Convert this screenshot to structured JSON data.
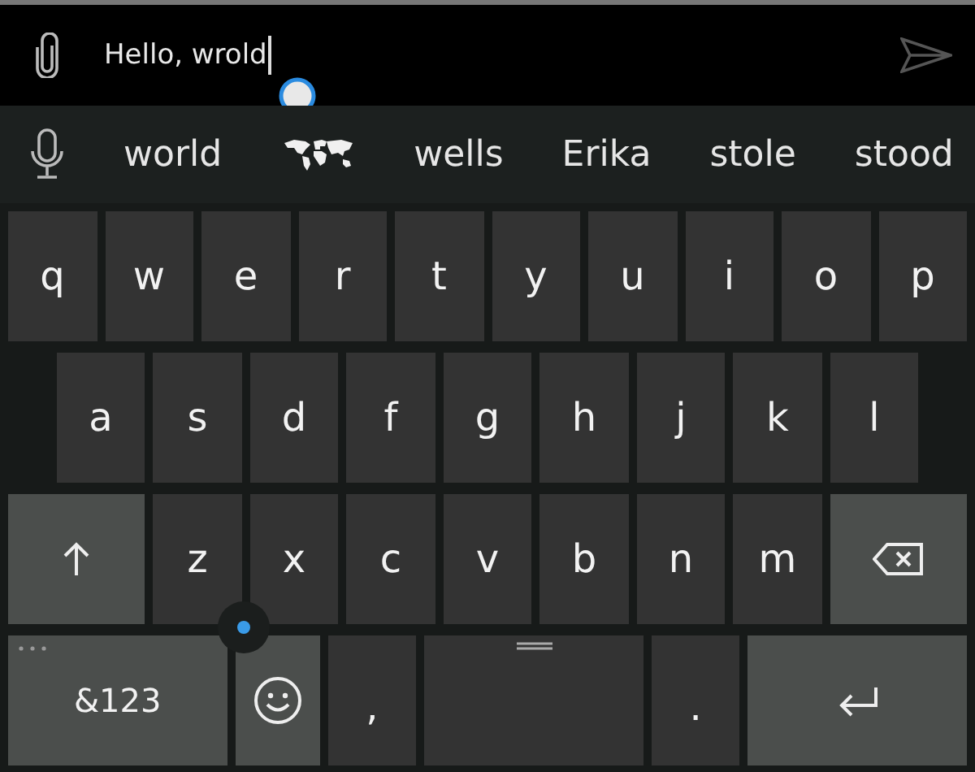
{
  "message_field": {
    "value": "Hello, wrold"
  },
  "suggestions": [
    {
      "kind": "word",
      "text": "world"
    },
    {
      "kind": "emoji"
    },
    {
      "kind": "word",
      "text": "wells"
    },
    {
      "kind": "word",
      "text": "Erika"
    },
    {
      "kind": "word",
      "text": "stole"
    },
    {
      "kind": "word",
      "text": "stood"
    }
  ],
  "keyboard": {
    "rows": [
      [
        {
          "kind": "letter",
          "text": "q"
        },
        {
          "kind": "letter",
          "text": "w"
        },
        {
          "kind": "letter",
          "text": "e"
        },
        {
          "kind": "letter",
          "text": "r"
        },
        {
          "kind": "letter",
          "text": "t"
        },
        {
          "kind": "letter",
          "text": "y"
        },
        {
          "kind": "letter",
          "text": "u"
        },
        {
          "kind": "letter",
          "text": "i"
        },
        {
          "kind": "letter",
          "text": "o"
        },
        {
          "kind": "letter",
          "text": "p"
        }
      ],
      [
        {
          "kind": "letter",
          "text": "a"
        },
        {
          "kind": "letter",
          "text": "s"
        },
        {
          "kind": "letter",
          "text": "d"
        },
        {
          "kind": "letter",
          "text": "f"
        },
        {
          "kind": "letter",
          "text": "g"
        },
        {
          "kind": "letter",
          "text": "h"
        },
        {
          "kind": "letter",
          "text": "j"
        },
        {
          "kind": "letter",
          "text": "k"
        },
        {
          "kind": "letter",
          "text": "l"
        }
      ],
      [
        {
          "kind": "shift"
        },
        {
          "kind": "letter",
          "text": "z"
        },
        {
          "kind": "letter",
          "text": "x"
        },
        {
          "kind": "letter",
          "text": "c"
        },
        {
          "kind": "letter",
          "text": "v"
        },
        {
          "kind": "letter",
          "text": "b"
        },
        {
          "kind": "letter",
          "text": "n"
        },
        {
          "kind": "letter",
          "text": "m"
        },
        {
          "kind": "backspace"
        }
      ],
      [
        {
          "kind": "symbols",
          "text": "&123"
        },
        {
          "kind": "emoji"
        },
        {
          "kind": "punct",
          "text": ","
        },
        {
          "kind": "space"
        },
        {
          "kind": "punct",
          "text": "."
        },
        {
          "kind": "enter"
        }
      ]
    ]
  }
}
